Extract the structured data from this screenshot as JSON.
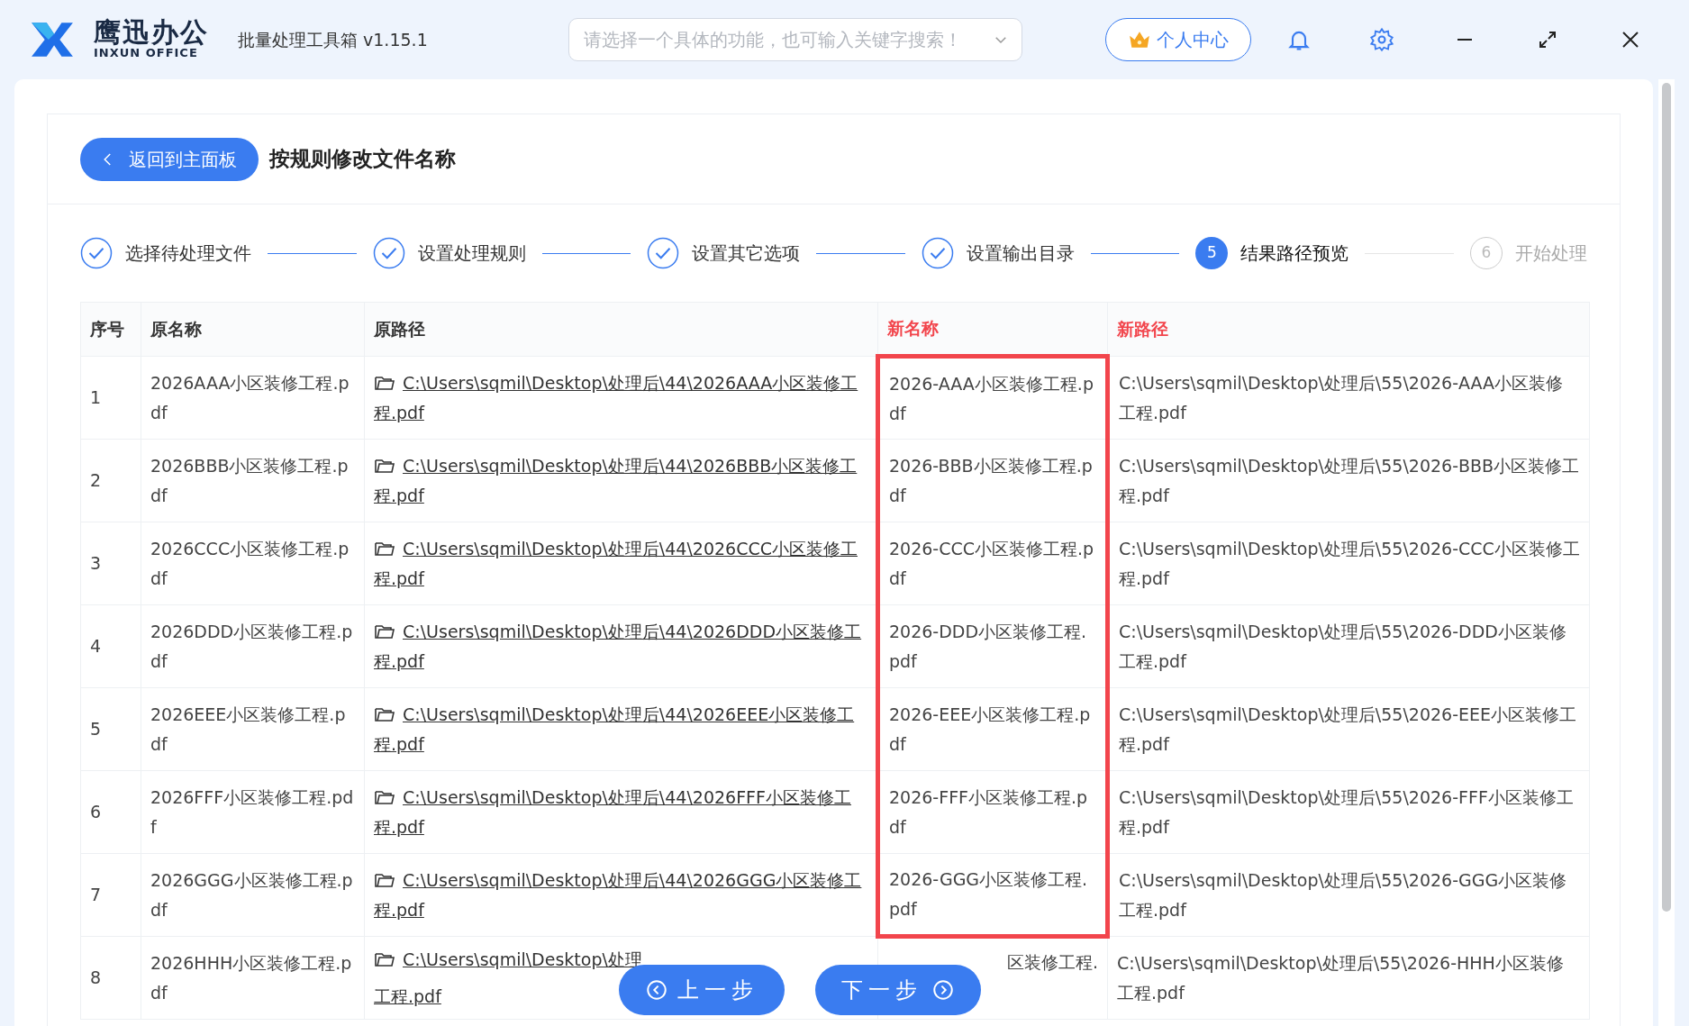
{
  "app": {
    "brand": "鹰迅办公",
    "brand_sub": "INXUN OFFICE",
    "title": "批量处理工具箱 v1.15.1",
    "search_placeholder": "请选择一个具体的功能，也可输入关键字搜索！",
    "user_button": "个人中心"
  },
  "page": {
    "back_button": "返回到主面板",
    "title": "按规则修改文件名称"
  },
  "steps": [
    {
      "label": "选择待处理文件",
      "done": true,
      "selected": false
    },
    {
      "label": "设置处理规则",
      "done": true,
      "selected": false
    },
    {
      "label": "设置其它选项",
      "done": true,
      "selected": false
    },
    {
      "label": "设置输出目录",
      "done": true,
      "selected": false
    },
    {
      "number": "5",
      "label": "结果路径预览",
      "done": false,
      "selected": true
    },
    {
      "number": "6",
      "label": "开始处理",
      "done": false,
      "selected": false
    }
  ],
  "table": {
    "columns": [
      {
        "label": "序号",
        "accent": false
      },
      {
        "label": "原名称",
        "accent": false
      },
      {
        "label": "原路径",
        "accent": false
      },
      {
        "label": "新名称",
        "accent": true
      },
      {
        "label": "新路径",
        "accent": true
      }
    ],
    "rows": [
      {
        "index": "1",
        "old_name": "2026AAA小区装修工程.pdf",
        "old_path": "C:\\Users\\sqmil\\Desktop\\处理后\\44\\2026AAA小区装修工程.pdf",
        "new_name": "2026-AAA小区装修工程.pdf",
        "new_path": "C:\\Users\\sqmil\\Desktop\\处理后\\55\\2026-AAA小区装修工程.pdf",
        "highlighted": true
      },
      {
        "index": "2",
        "old_name": "2026BBB小区装修工程.pdf",
        "old_path": "C:\\Users\\sqmil\\Desktop\\处理后\\44\\2026BBB小区装修工程.pdf",
        "new_name": "2026-BBB小区装修工程.pdf",
        "new_path": "C:\\Users\\sqmil\\Desktop\\处理后\\55\\2026-BBB小区装修工程.pdf",
        "highlighted": true
      },
      {
        "index": "3",
        "old_name": "2026CCC小区装修工程.pdf",
        "old_path": "C:\\Users\\sqmil\\Desktop\\处理后\\44\\2026CCC小区装修工程.pdf",
        "new_name": "2026-CCC小区装修工程.pdf",
        "new_path": "C:\\Users\\sqmil\\Desktop\\处理后\\55\\2026-CCC小区装修工程.pdf",
        "highlighted": true
      },
      {
        "index": "4",
        "old_name": "2026DDD小区装修工程.pdf",
        "old_path": "C:\\Users\\sqmil\\Desktop\\处理后\\44\\2026DDD小区装修工程.pdf",
        "new_name": "2026-DDD小区装修工程.pdf",
        "new_path": "C:\\Users\\sqmil\\Desktop\\处理后\\55\\2026-DDD小区装修工程.pdf",
        "highlighted": true
      },
      {
        "index": "5",
        "old_name": "2026EEE小区装修工程.pdf",
        "old_path": "C:\\Users\\sqmil\\Desktop\\处理后\\44\\2026EEE小区装修工程.pdf",
        "new_name": "2026-EEE小区装修工程.pdf",
        "new_path": "C:\\Users\\sqmil\\Desktop\\处理后\\55\\2026-EEE小区装修工程.pdf",
        "highlighted": true
      },
      {
        "index": "6",
        "old_name": "2026FFF小区装修工程.pdf",
        "old_path": "C:\\Users\\sqmil\\Desktop\\处理后\\44\\2026FFF小区装修工程.pdf",
        "new_name": "2026-FFF小区装修工程.pdf",
        "new_path": "C:\\Users\\sqmil\\Desktop\\处理后\\55\\2026-FFF小区装修工程.pdf",
        "highlighted": true
      },
      {
        "index": "7",
        "old_name": "2026GGG小区装修工程.pdf",
        "old_path": "C:\\Users\\sqmil\\Desktop\\处理后\\44\\2026GGG小区装修工程.pdf",
        "new_name": "2026-GGG小区装修工程.pdf",
        "new_path": "C:\\Users\\sqmil\\Desktop\\处理后\\55\\2026-GGG小区装修工程.pdf",
        "highlighted": true
      },
      {
        "index": "8",
        "old_name": "2026HHH小区装修工程.pdf",
        "old_path": "C:\\Users\\sqmil\\Desktop\\处理",
        "old_path_line2": "工程.pdf",
        "new_name": "区装修工程.",
        "new_path": "C:\\Users\\sqmil\\Desktop\\处理后\\55\\2026-HHH小区装修工程.pdf",
        "highlighted": false
      }
    ]
  },
  "footer": {
    "prev_button": "上一步",
    "next_button": "下一步"
  }
}
